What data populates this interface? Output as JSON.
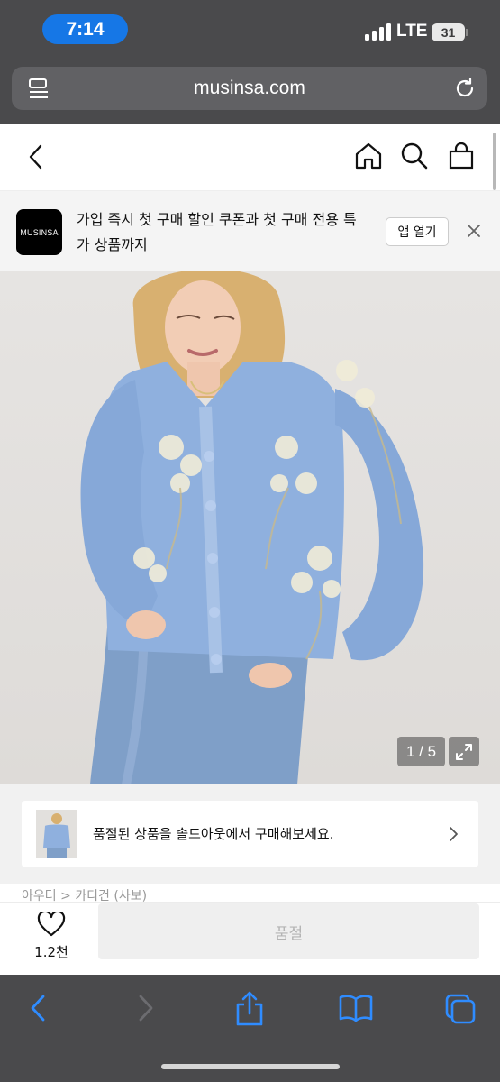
{
  "status_bar": {
    "time": "7:14",
    "network": "LTE",
    "battery": "31"
  },
  "browser": {
    "url": "musinsa.com"
  },
  "app_banner": {
    "logo": "MUSINSA",
    "message": "가입 즉시 첫 구매 할인 쿠폰과 첫 구매 전용 특가 상품까지",
    "open_app_label": "앱 열기"
  },
  "product": {
    "image_counter": "1 / 5",
    "soldout_notice": "품절된 상품을 솔드아웃에서 구매해보세요.",
    "breadcrumb_peek": "아우터 > 카디건 (사보)",
    "like_count": "1.2천",
    "buy_button_label": "품절"
  },
  "colors": {
    "time_pill": "#1677e6",
    "toolbar_bg": "#4a4a4c",
    "toolbar_icon": "#2f8cff",
    "sweater": "#8fb0de"
  },
  "icons": [
    "reader-icon",
    "reload-icon",
    "back-icon",
    "home-icon",
    "search-icon",
    "bag-icon",
    "close-icon",
    "expand-icon",
    "chevron-right-icon",
    "heart-icon",
    "safari-back-icon",
    "safari-forward-icon",
    "share-icon",
    "bookmarks-icon",
    "tabs-icon"
  ]
}
